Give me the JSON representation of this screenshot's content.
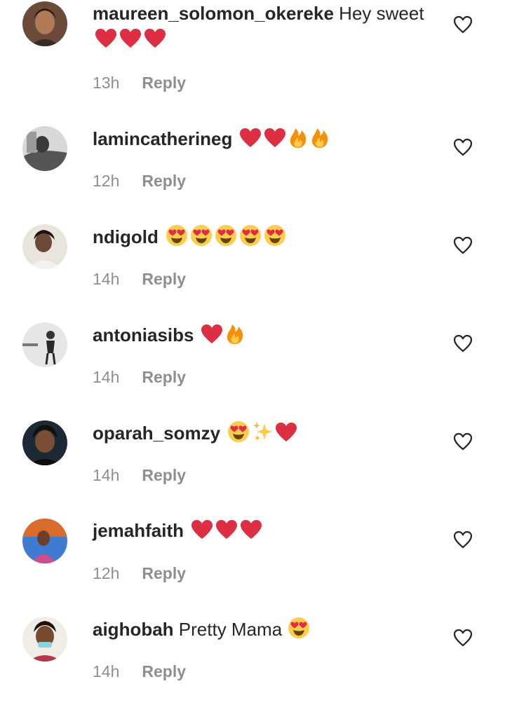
{
  "icons": {
    "like": "heart-outline-icon",
    "red_heart": "red-heart-emoji",
    "fire": "fire-emoji",
    "heart_eyes": "heart-eyes-emoji",
    "sparkles": "sparkles-emoji"
  },
  "colors": {
    "username": "#262626",
    "meta": "#8e8e8e",
    "heart_emoji": "#dd2e44",
    "fire_outer": "#f4900c",
    "fire_inner": "#ffcc4d"
  },
  "comments": [
    {
      "username": "maureen_solomon_okereke",
      "text": "Hey sweet",
      "emojis": [
        "red_heart",
        "red_heart",
        "red_heart"
      ],
      "time": "13h",
      "reply": "Reply"
    },
    {
      "username": "lamincatherineg",
      "text": "",
      "emojis": [
        "red_heart",
        "red_heart",
        "fire",
        "fire"
      ],
      "time": "12h",
      "reply": "Reply"
    },
    {
      "username": "ndigold",
      "text": "",
      "emojis": [
        "heart_eyes",
        "heart_eyes",
        "heart_eyes",
        "heart_eyes",
        "heart_eyes"
      ],
      "time": "14h",
      "reply": "Reply"
    },
    {
      "username": "antoniasibs",
      "text": "",
      "emojis": [
        "red_heart",
        "fire"
      ],
      "time": "14h",
      "reply": "Reply"
    },
    {
      "username": "oparah_somzy",
      "text": "",
      "emojis": [
        "heart_eyes",
        "sparkles",
        "red_heart"
      ],
      "time": "14h",
      "reply": "Reply"
    },
    {
      "username": "jemahfaith",
      "text": "",
      "emojis": [
        "red_heart",
        "red_heart",
        "red_heart"
      ],
      "time": "12h",
      "reply": "Reply"
    },
    {
      "username": "aighobah",
      "text": "Pretty Mama",
      "emojis": [
        "heart_eyes"
      ],
      "time": "14h",
      "reply": "Reply"
    }
  ]
}
